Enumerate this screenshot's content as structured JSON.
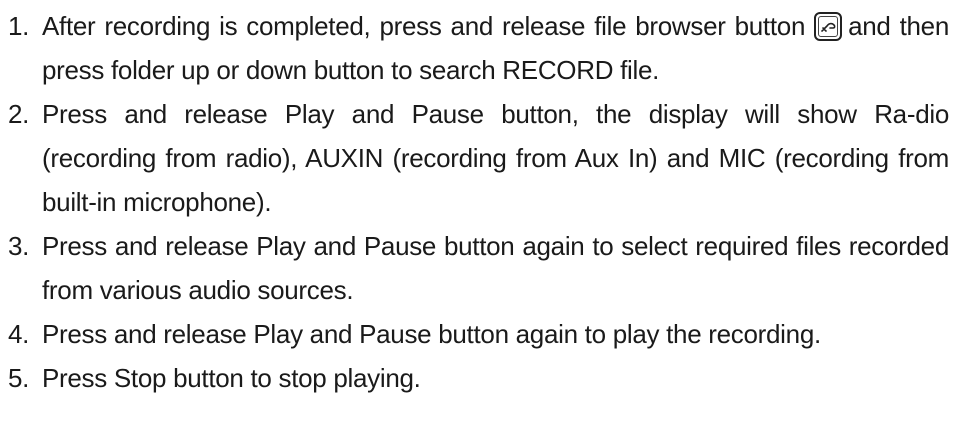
{
  "steps": [
    {
      "number": "1.",
      "text_before_icon": "After recording is completed, press and release file browser button ",
      "icon": "file-browser-button-icon",
      "text_after_icon": "and then press folder up or down button to search RECORD file."
    },
    {
      "number": "2.",
      "text": "Press and release Play and Pause button, the display will show Ra-dio (recording from radio), AUXIN (recording from Aux In) and MIC (recording from built-in microphone)."
    },
    {
      "number": "3.",
      "text": "Press and release Play and Pause button again to select required files recorded from various audio sources."
    },
    {
      "number": "4.",
      "text": "Press and release Play and Pause button again to play the recording."
    },
    {
      "number": "5.",
      "text": "Press Stop button to stop playing."
    }
  ]
}
